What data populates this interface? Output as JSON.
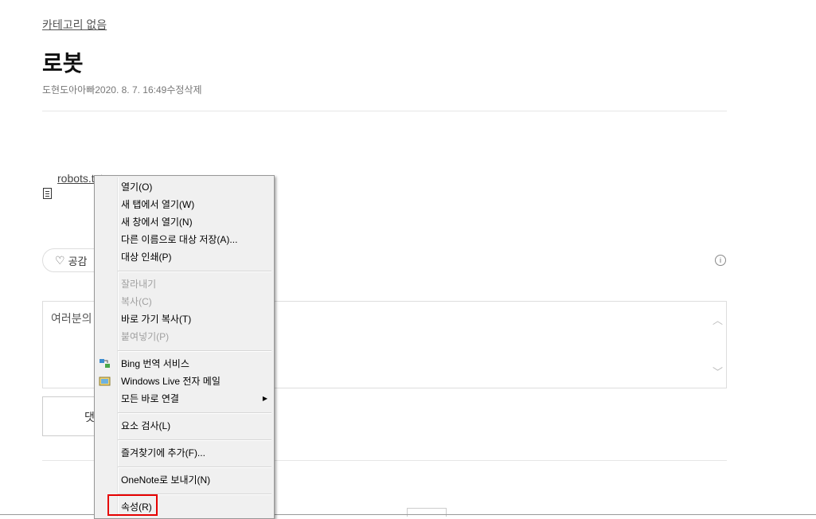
{
  "post": {
    "category": "카테고리 없음",
    "title": "로봇",
    "author": "도현도아아빠",
    "date": "2020. 8. 7. 16:49",
    "edit": "수정",
    "delete": "삭제",
    "attachment": "robots.txt"
  },
  "like": {
    "label": "공감"
  },
  "comment": {
    "placeholder": "여러분의",
    "submit": "댓"
  },
  "context_menu": {
    "items": [
      {
        "label": "열기(O)"
      },
      {
        "label": "새 탭에서 열기(W)"
      },
      {
        "label": "새 창에서 열기(N)"
      },
      {
        "label": "다른 이름으로 대상 저장(A)..."
      },
      {
        "label": "대상 인쇄(P)"
      },
      {
        "label": "잘라내기",
        "disabled": true
      },
      {
        "label": "복사(C)",
        "disabled": true
      },
      {
        "label": "바로 가기 복사(T)"
      },
      {
        "label": "붙여넣기(P)",
        "disabled": true
      },
      {
        "label": "Bing 번역 서비스",
        "icon": "bing-translate-icon"
      },
      {
        "label": "Windows Live 전자 메일",
        "icon": "windows-live-mail-icon"
      },
      {
        "label": "모든 바로 연결",
        "submenu": true
      },
      {
        "label": "요소 검사(L)"
      },
      {
        "label": "즐겨찾기에 추가(F)..."
      },
      {
        "label": "OneNote로 보내기(N)"
      },
      {
        "label": "속성(R)"
      }
    ]
  },
  "colors": {
    "highlight_border": "#e60000",
    "menu_bg": "#f0f0f0"
  }
}
